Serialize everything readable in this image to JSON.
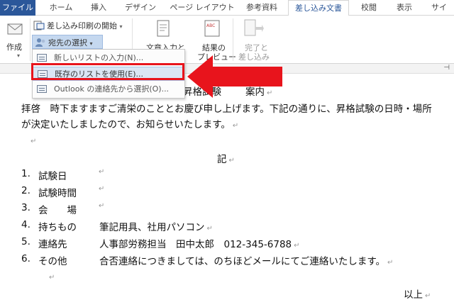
{
  "ribbon": {
    "tabs": [
      {
        "label": "ファイル",
        "active": false
      },
      {
        "label": "ホーム",
        "active": false
      },
      {
        "label": "挿入",
        "active": false
      },
      {
        "label": "デザイン",
        "active": false
      },
      {
        "label": "ページ レイアウト",
        "active": false
      },
      {
        "label": "参考資料",
        "active": false
      },
      {
        "label": "差し込み文書",
        "active": true
      },
      {
        "label": "校閲",
        "active": false
      },
      {
        "label": "表示",
        "active": false
      },
      {
        "label": "サイ",
        "active": false
      }
    ],
    "create_label": "作成",
    "start_merge_label": "差し込み印刷の開始",
    "select_recipients_label": "宛先の選択",
    "insert_text_label": "文章入力と",
    "preview_label": "結果の",
    "preview_label2": "プレビュー",
    "finish_label": "完了と",
    "finish_label2": "差し込み",
    "abc_icon_text": "ABC"
  },
  "dropdown": {
    "items": [
      {
        "label": "新しいリストの入力(N)...",
        "icon": "new-list-icon",
        "highlighted": false
      },
      {
        "label": "既存のリストを使用(E)...",
        "icon": "existing-list-icon",
        "highlighted": true
      },
      {
        "label": "Outlook の連絡先から選択(O)...",
        "icon": "outlook-contacts-icon",
        "highlighted": false
      }
    ]
  },
  "colors": {
    "file_tab": "#2b579a",
    "highlight": "#dbe6f4",
    "annotation_red": "#e8141c"
  },
  "document": {
    "title_fragment": "昇格試験",
    "title_tail": "案内",
    "line1": "拝啓　時下ますますご清栄のこととお慶び申し上げます。下記の通りに、昇格試験の日時・場所",
    "line2": "が決定いたしましたので、お知らせいたします。",
    "ki": "記",
    "items": [
      {
        "num": "1.",
        "label": "試験日",
        "value": ""
      },
      {
        "num": "2.",
        "label": "試験時間",
        "value": ""
      },
      {
        "num": "3.",
        "label": "会　　場",
        "value": ""
      },
      {
        "num": "4.",
        "label": "持ちもの",
        "value": "筆記用具、社用パソコン"
      },
      {
        "num": "5.",
        "label": "連絡先",
        "value": "人事部労務担当　田中太郎　012-345-6788"
      },
      {
        "num": "6.",
        "label": "その他",
        "value": "合否連絡につきましては、のちほどメールにてご連絡いたします。"
      }
    ],
    "closing": "以上",
    "paragraph_mark": "↵"
  }
}
